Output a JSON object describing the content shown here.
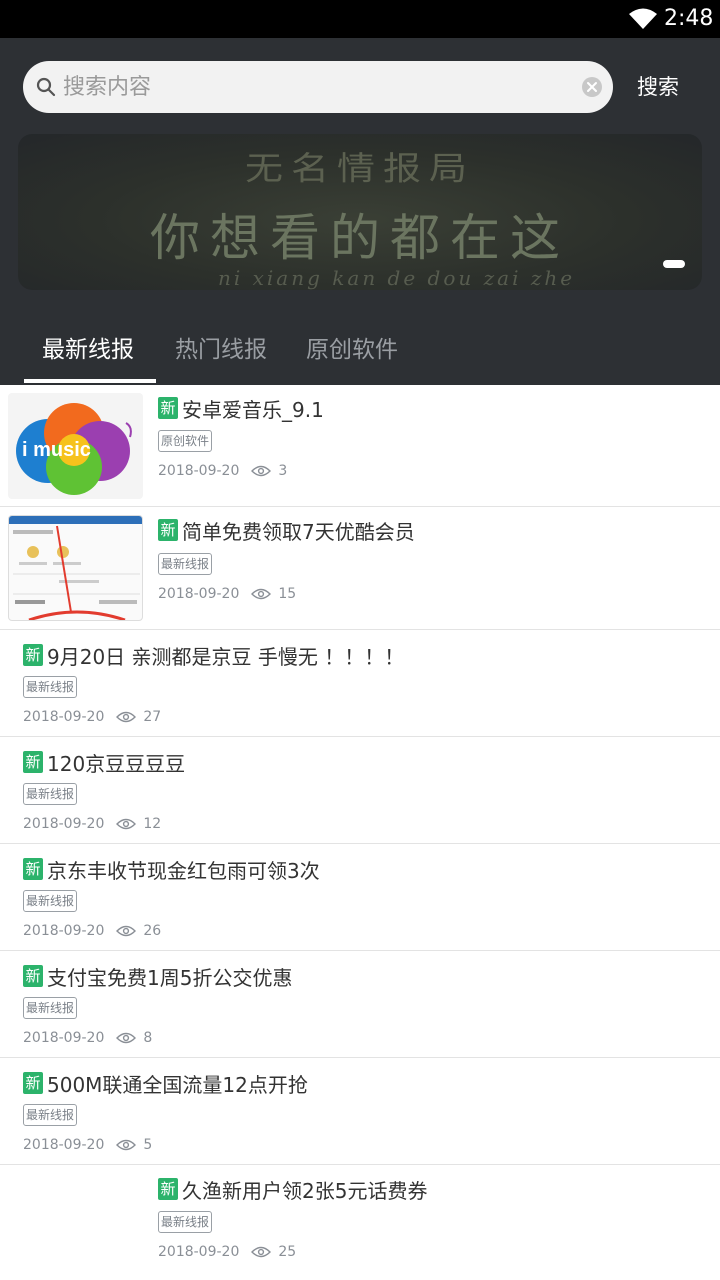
{
  "status_bar": {
    "time": "2:48"
  },
  "search": {
    "placeholder": "搜索内容",
    "button_label": "搜索"
  },
  "banner": {
    "line1": "无名情报局",
    "line2": "你想看的都在这",
    "line3": "ni xiang kan de dou zai zhe"
  },
  "tabs": [
    {
      "label": "最新线报",
      "active": true
    },
    {
      "label": "热门线报",
      "active": false
    },
    {
      "label": "原创软件",
      "active": false
    }
  ],
  "badge_new": "新",
  "items": [
    {
      "title": "安卓爱音乐_9.1",
      "tag": "原创软件",
      "date": "2018-09-20",
      "views": "3",
      "thumb": "music-logo"
    },
    {
      "title": "简单免费领取7天优酷会员",
      "tag": "最新线报",
      "date": "2018-09-20",
      "views": "15",
      "thumb": "screenshot"
    },
    {
      "title": "9月20日 亲测都是京豆 手慢无 ！！！！",
      "tag": "最新线报",
      "date": "2018-09-20",
      "views": "27"
    },
    {
      "title": "120京豆豆豆豆",
      "tag": "最新线报",
      "date": "2018-09-20",
      "views": "12"
    },
    {
      "title": "京东丰收节现金红包雨可领3次",
      "tag": "最新线报",
      "date": "2018-09-20",
      "views": "26"
    },
    {
      "title": "支付宝免费1周5折公交优惠",
      "tag": "最新线报",
      "date": "2018-09-20",
      "views": "8"
    },
    {
      "title": "500M联通全国流量12点开抢",
      "tag": "最新线报",
      "date": "2018-09-20",
      "views": "5"
    },
    {
      "title": "久渔新用户领2张5元话费券",
      "tag": "最新线报",
      "date": "2018-09-20",
      "views": "25",
      "thumb": "blank"
    }
  ],
  "colors": {
    "header_bg": "#2d3034",
    "badge_green": "#2cb36b",
    "status_bar": "#000000"
  }
}
